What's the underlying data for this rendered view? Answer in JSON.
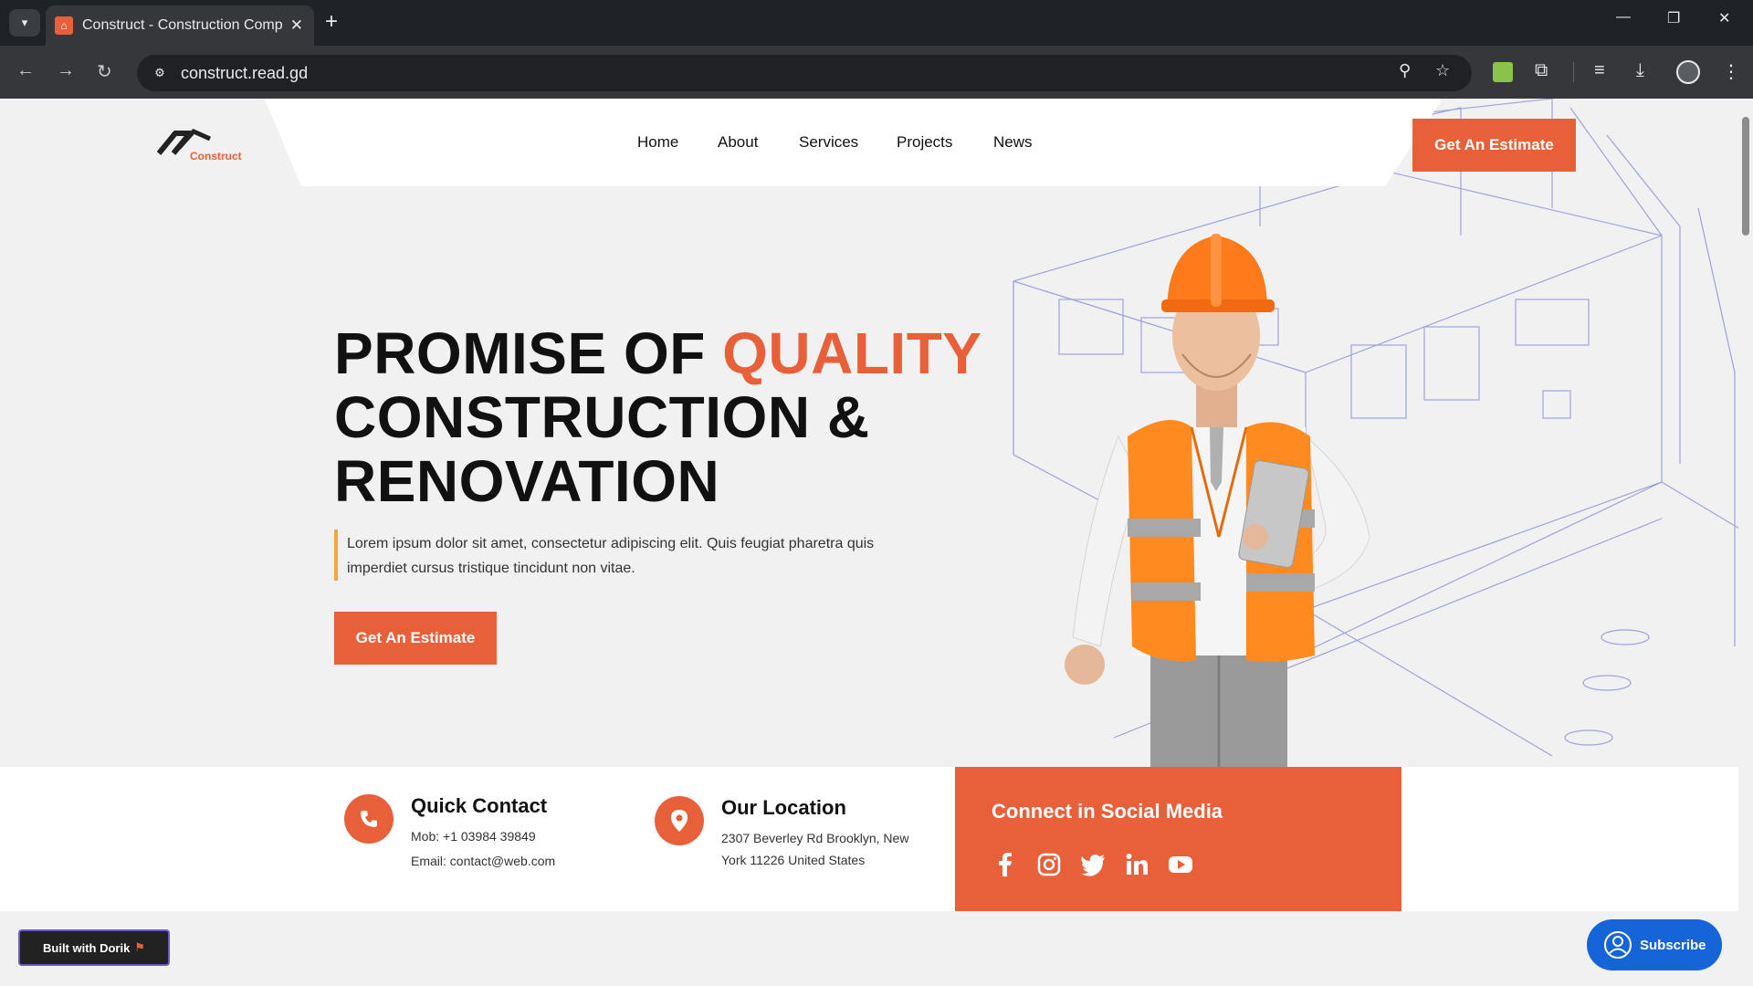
{
  "browser": {
    "tab_title": "Construct - Construction Comp",
    "url": "construct.read.gd",
    "new_tab_symbol": "+",
    "tab_close_symbol": "✕"
  },
  "site": {
    "logo_text": "Construct",
    "nav": [
      "Home",
      "About",
      "Services",
      "Projects",
      "News"
    ],
    "header_cta": "Get An Estimate",
    "accent_color": "#e8603a"
  },
  "hero": {
    "title_line1_a": "PROMISE OF ",
    "title_line1_b": "QUALITY",
    "title_line2": "CONSTRUCTION &",
    "title_line3": "RENOVATION",
    "description": "Lorem ipsum dolor sit amet, consectetur adipiscing elit. Quis feugiat pharetra quis imperdiet cursus tristique tincidunt non vitae.",
    "cta": "Get An Estimate"
  },
  "contact": {
    "quick_title": "Quick Contact",
    "quick_mob": "Mob: +1 03984 39849",
    "quick_email": "Email: contact@web.com",
    "location_title": "Our Location",
    "location_line1": "2307 Beverley Rd Brooklyn, New",
    "location_line2": "York 11226 United States",
    "social_title": "Connect in Social Media",
    "social_icons": [
      "facebook-icon",
      "instagram-icon",
      "twitter-icon",
      "linkedin-icon",
      "youtube-icon"
    ]
  },
  "badges": {
    "dorik": "Built with Dorik",
    "subscribe": "Subscribe"
  }
}
